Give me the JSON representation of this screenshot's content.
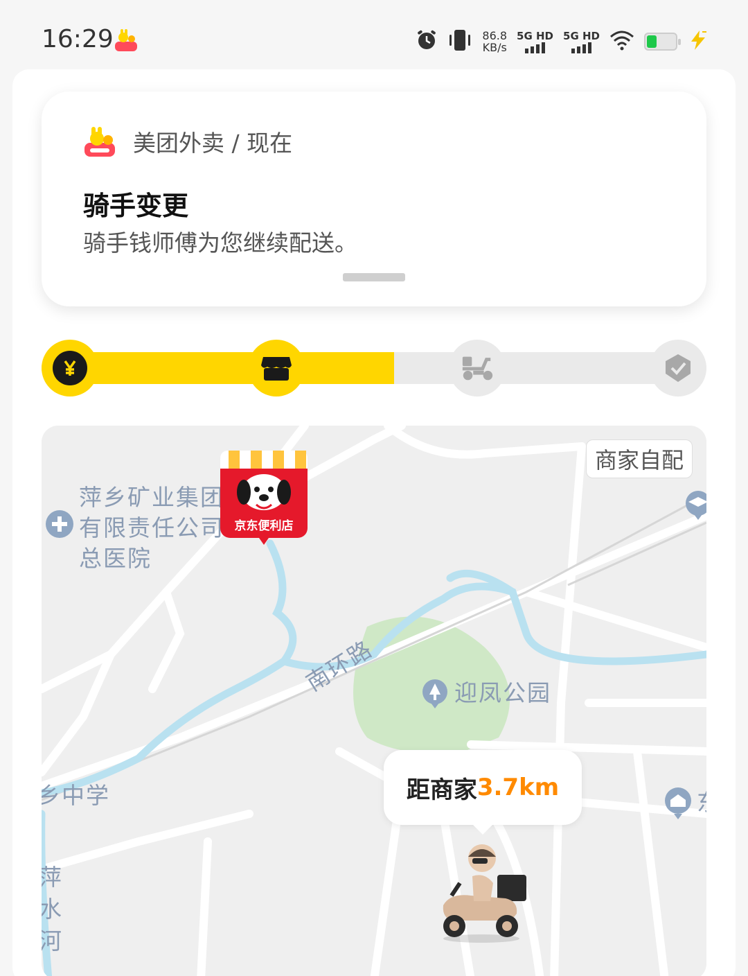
{
  "status_bar": {
    "time": "16:29",
    "net_speed_value": "86.8",
    "net_speed_unit": "KB/s",
    "signal_1_label": "5G HD",
    "signal_2_label": "5G HD",
    "battery_level": 0.35,
    "icons": [
      "meituan-app-icon",
      "alarm-icon",
      "vibrate-icon",
      "wifi-icon",
      "battery-icon",
      "charging-icon"
    ]
  },
  "notification": {
    "header": "美团外卖 / 现在",
    "title": "骑手变更",
    "body": "骑手钱师傅为您继续配送。"
  },
  "progress": {
    "fill_fraction": 0.53,
    "steps": [
      {
        "icon": "yen-icon",
        "state": "done"
      },
      {
        "icon": "store-icon",
        "state": "done"
      },
      {
        "icon": "scooter-icon",
        "state": "pending"
      },
      {
        "icon": "check-icon",
        "state": "pending"
      }
    ]
  },
  "map": {
    "delivery_mode": "商家自配",
    "store_sign": "京东便利店",
    "labels": {
      "hospital_line1": "萍乡矿业集团",
      "hospital_line2": "有限责任公司",
      "hospital_line3": "总医院",
      "road": "南环路",
      "park": "迎凤公园",
      "school": "乡中学",
      "river_1": "萍",
      "river_2": "水",
      "river_3": "河",
      "east": "东"
    },
    "distance_prefix": "距商家",
    "distance_value": "3.7km"
  },
  "colors": {
    "accent_yellow": "#ffd600",
    "distance_orange": "#ff8a00",
    "map_label": "#8a9bb3",
    "river": "#b9e1f0",
    "park": "#cfe8c6"
  }
}
